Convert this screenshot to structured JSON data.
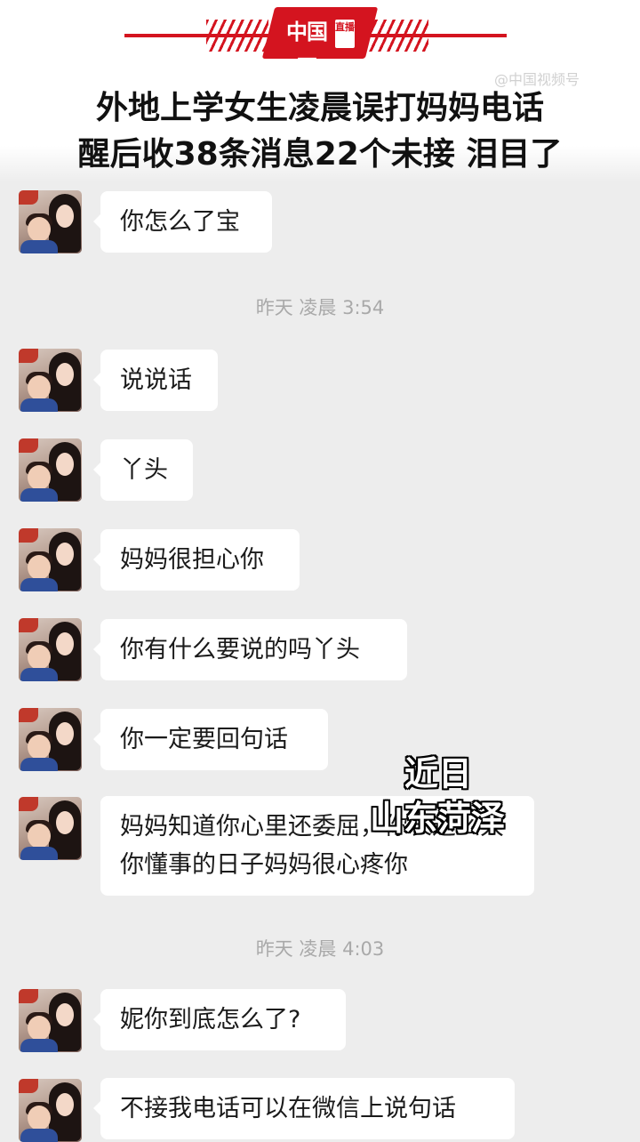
{
  "header": {
    "logo_text": "中国网",
    "logo_live": "直播",
    "watermark": "@中国视频号",
    "headline_line1": "外地上学女生凌晨误打妈妈电话",
    "headline_line2": "醒后收38条消息22个未接 泪目了"
  },
  "chat": {
    "messages": [
      {
        "text": "你怎么了宝"
      },
      {
        "text": "说说话"
      },
      {
        "text": "丫头"
      },
      {
        "text": "妈妈很担心你"
      },
      {
        "text": "你有什么要说的吗丫头"
      },
      {
        "text": "你一定要回句话"
      },
      {
        "line1": "妈妈知道你心里还委屈，你长这么大",
        "line2": "你懂事的日子妈妈很心疼你"
      },
      {
        "text": "妮你到底怎么了?"
      },
      {
        "text": "不接我电话可以在微信上说句话"
      }
    ],
    "timestamps": [
      "昨天 凌晨 3:54",
      "昨天 凌晨 4:03"
    ]
  },
  "caption": {
    "line1": "近日",
    "line2": "山东菏泽"
  },
  "colors": {
    "brand_red": "#d4141f",
    "chat_background": "#ededed",
    "bubble": "#ffffff"
  }
}
